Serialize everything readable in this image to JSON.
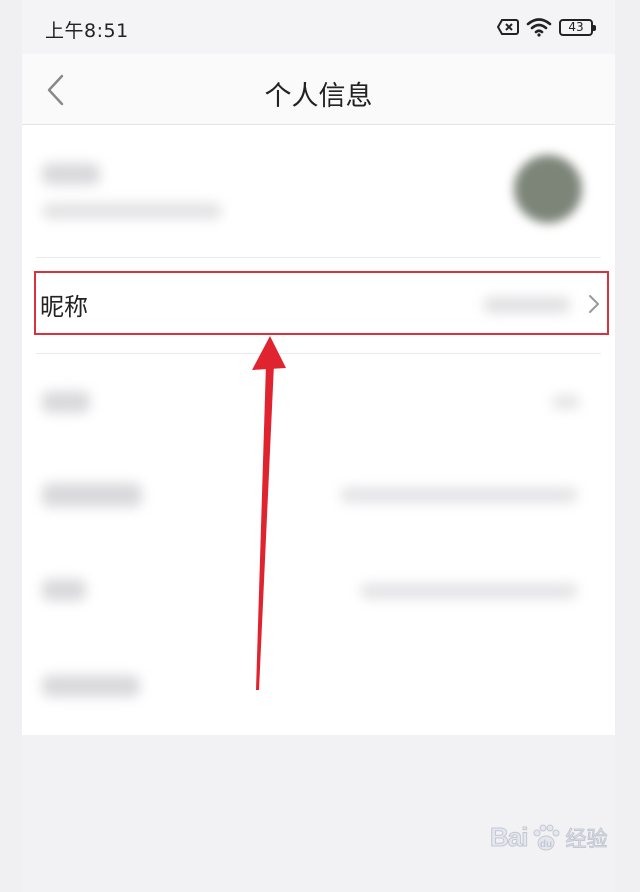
{
  "status_bar": {
    "time": "上午8:51",
    "battery_level": "43",
    "icons": [
      "sim-off-icon",
      "wifi-icon",
      "battery-icon"
    ]
  },
  "nav": {
    "title": "个人信息",
    "back_icon": "chevron-left-icon"
  },
  "profile": {
    "nickname_label": "昵称",
    "nickname_chevron": "chevron-right-icon"
  },
  "annotation": {
    "box_color": "#d9313d",
    "arrow_color": "#e0242f"
  },
  "watermark": {
    "brand": "Bai",
    "brand_suffix": "du",
    "sub": "经验"
  }
}
